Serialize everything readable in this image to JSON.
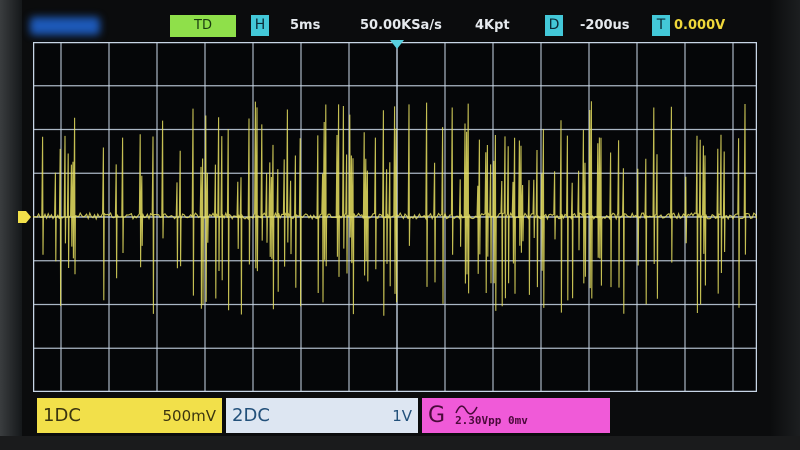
{
  "header": {
    "trigger_mode": "TD",
    "horizontal_icon": "H",
    "timebase": "5ms",
    "sample_rate": "50.00KSa/s",
    "memory_depth": "4Kpt",
    "delay_icon": "D",
    "delay": "-200us",
    "trigger_icon": "T",
    "trigger_level": "0.000V"
  },
  "channels": {
    "ch1": {
      "label": "1DC",
      "scale": "500mV",
      "color": "#f2e04a"
    },
    "ch2": {
      "label": "2DC",
      "scale": "1V",
      "color": "#dde6f2"
    },
    "gen": {
      "label": "G",
      "icon": "sine-wave-icon",
      "amplitude": "2.30Vpp",
      "offset": "0mv",
      "color": "#f05ad8"
    }
  },
  "colors": {
    "trace": "#e8e060",
    "grid": "#c8d6e6",
    "marker": "#58d0e0"
  }
}
